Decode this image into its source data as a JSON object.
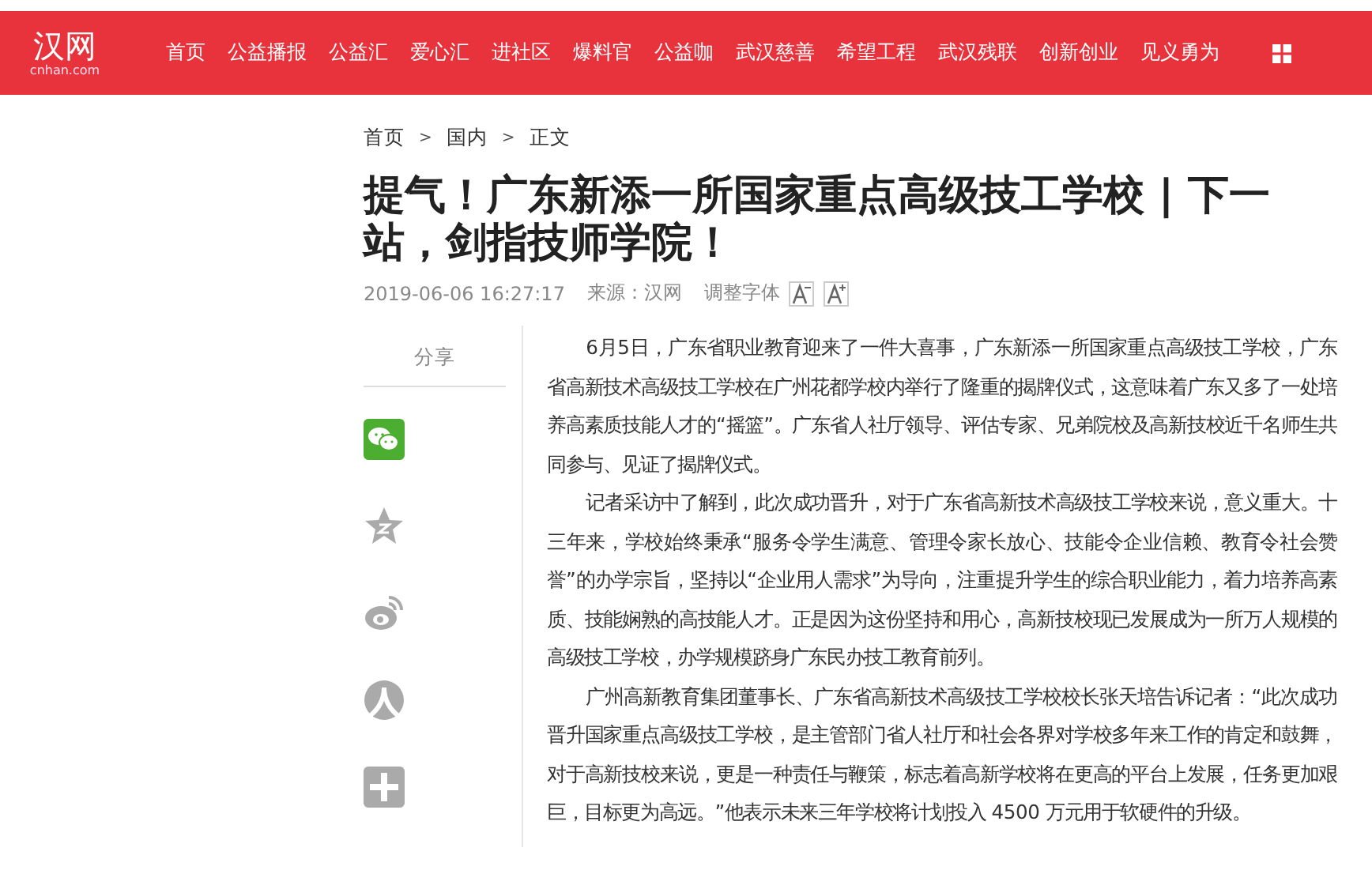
{
  "logo": {
    "name": "汉网",
    "domain": "cnhan.com"
  },
  "nav": {
    "items": [
      {
        "label": "首页"
      },
      {
        "label": "公益播报"
      },
      {
        "label": "公益汇"
      },
      {
        "label": "爱心汇"
      },
      {
        "label": "进社区"
      },
      {
        "label": "爆料官"
      },
      {
        "label": "公益咖"
      },
      {
        "label": "武汉慈善"
      },
      {
        "label": "希望工程"
      },
      {
        "label": "武汉残联"
      },
      {
        "label": "创新创业"
      },
      {
        "label": "见义勇为"
      }
    ]
  },
  "breadcrumb": {
    "items": [
      "首页",
      "国内",
      "正文"
    ],
    "separator": ">"
  },
  "article": {
    "title": "提气！广东新添一所国家重点高级技工学校 | 下一站，剑指技师学院！",
    "date": "2019-06-06 16:27:17",
    "source": "来源：汉网",
    "font_adjust_label": "调整字体",
    "paragraphs": [
      "6月5日，广东省职业教育迎来了一件大喜事，广东新添一所国家重点高级技工学校，广东省高新技术高级技工学校在广州花都学校内举行了隆重的揭牌仪式，这意味着广东又多了一处培养高素质技能人才的“摇篮”。广东省人社厅领导、评估专家、兄弟院校及高新技校近千名师生共同参与、见证了揭牌仪式。",
      "记者采访中了解到，此次成功晋升，对于广东省高新技术高级技工学校来说，意义重大。十三年来，学校始终秉承“服务令学生满意、管理令家长放心、技能令企业信赖、教育令社会赞誉”的办学宗旨，坚持以“企业用人需求”为导向，注重提升学生的综合职业能力，着力培养高素质、技能娴熟的高技能人才。正是因为这份坚持和用心，高新技校现已发展成为一所万人规模的高级技工学校，办学规模跻身广东民办技工教育前列。",
      "广州高新教育集团董事长、广东省高新技术高级技工学校校长张天培告诉记者：“此次成功晋升国家重点高级技工学校，是主管部门省人社厅和社会各界对学校多年来工作的肯定和鼓舞，对于高新技校来说，更是一种责任与鞭策，标志着高新学校将在更高的平台上发展，任务更加艰巨，目标更为高远。”他表示未来三年学校将计划投入 4500 万元用于软硬件的升级。"
    ]
  },
  "share": {
    "label": "分享",
    "items": [
      {
        "kind": "wechat"
      },
      {
        "kind": "qzone"
      },
      {
        "kind": "weibo"
      },
      {
        "kind": "renren"
      },
      {
        "kind": "more"
      }
    ]
  }
}
